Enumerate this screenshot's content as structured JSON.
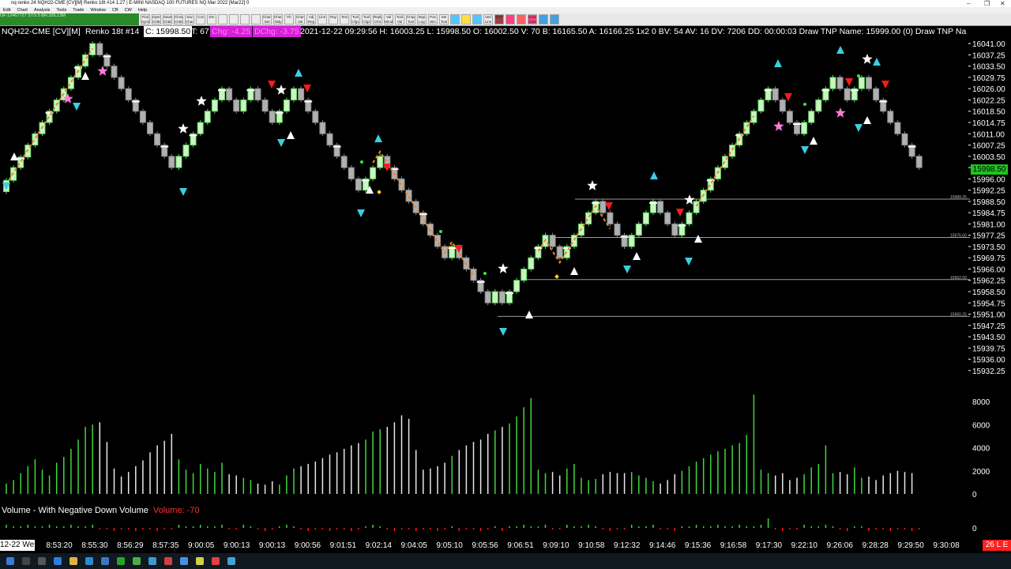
{
  "window": {
    "title": "nq renko 24 NQH22-CME [CV][M] Renko 18t #14 1.27 | E-MINI NASDAQ 100 FUTURES NQ Mar 2022 [Mar22]  0",
    "controls": [
      "–",
      "❐",
      "✕"
    ]
  },
  "menu": [
    "Edit",
    "Chart",
    "Analysis",
    "Tools",
    "Trade",
    "Window",
    "CB",
    "CW",
    "Help"
  ],
  "statuschip": "OF:12467727 ST:5.5 BR:326.13M",
  "toolbar": [
    "Find Symb",
    "Open Chtbook",
    "Save Chtbook",
    "Close Chtbook",
    "Sav Chart",
    "Con",
    "Dm",
    "",
    "",
    "",
    "",
    "Chart Set",
    "Chart Stdy",
    "Fb",
    "Chart Val",
    "Adj Reg",
    "Line",
    "Ray",
    "Text",
    "Tool Cfg1",
    "Tool Cfg2",
    "Replay Chrt",
    "Val Wind",
    "Tool Val",
    "Cmpct Tool Vol",
    "Myp Log",
    "Pos Win",
    "Ste Tool",
    "",
    "",
    "",
    "Vert Line",
    "DVP",
    "",
    "",
    "Erase Lines",
    "",
    ""
  ],
  "infobar": {
    "symbol": "NQH22-CME [CV][M]",
    "bars": "Renko 18t #14",
    "close": "C: 15998.50",
    "ticks": "T: 67",
    "chg": "Chg: -4.25",
    "dchg": "DChg: -3.75",
    "details": "2021-12-22 09:29:56 H: 16003.25 L: 15998.50 O: 16002.50 V: 70 B: 16165.50 A: 16166.25 1x2 0 BV: 54 AV: 16 DV: 7206 DD: 00:00:03 Draw TNP  Name: 15999.00  (0)  Draw TNP  Na"
  },
  "price_axis": [
    "16041.00",
    "16037.25",
    "16033.50",
    "16029.75",
    "16026.00",
    "16022.25",
    "16018.50",
    "16014.75",
    "16011.00",
    "16007.25",
    "16003.50",
    "15999.75",
    "15996.00",
    "15992.25",
    "15988.50",
    "15984.75",
    "15981.00",
    "15977.25",
    "15973.50",
    "15969.75",
    "15966.00",
    "15962.25",
    "15958.50",
    "15954.75",
    "15951.00",
    "15947.25",
    "15943.50",
    "15939.75",
    "15936.00",
    "15932.25"
  ],
  "last_price": "15998.50",
  "hlines": [
    {
      "label": "15989.25",
      "price": 15989.25
    },
    {
      "label": "15976.50",
      "price": 15976.5
    },
    {
      "label": "15962.50",
      "price": 15962.5
    },
    {
      "label": "15950.25",
      "price": 15950.25
    }
  ],
  "volume_axis": [
    "8000",
    "6000",
    "4000",
    "2000",
    "0"
  ],
  "delta_axis": "0",
  "volume_study": {
    "title": "Volume - With Negative Down Volume",
    "value": "Volume: -70"
  },
  "time_axis": [
    "8:53:20",
    "8:55:30",
    "8:56:29",
    "8:57:35",
    "9:00:05",
    "9:00:13",
    "9:00:13",
    "9:00:56",
    "9:01:51",
    "9:02:14",
    "9:04:05",
    "9:05:10",
    "9:05:56",
    "9:06:51",
    "9:09:10",
    "9:10:58",
    "9:12:32",
    "9:14:46",
    "9:15:36",
    "9:16:58",
    "9:17:30",
    "9:22:10",
    "9:26:06",
    "9:28:28",
    "9:29:50",
    "9:30:08"
  ],
  "date_box": "12-22 We",
  "now_box": "26 L E",
  "colors": {
    "up": "#5fd35f",
    "up_fill": "#c8f5c0",
    "down": "#8a8a8a",
    "down_fill": "#b0b0b0",
    "signal_orange": "#e8862a",
    "sell": "#ff1a1a",
    "buy_arrow": "#39d0e0",
    "star_pink": "#ff7ad9",
    "vol_up": "#3fd83f",
    "vol_down": "#e8e8e8"
  },
  "chart_data": {
    "type": "renko",
    "bricks_close": [
      15995.5,
      15999.75,
      16003.25,
      16007.25,
      16011,
      16014.75,
      16018.5,
      16022.25,
      16026,
      16029.75,
      16033.5,
      16037.25,
      16041,
      16037.25,
      16033.5,
      16029.75,
      16026,
      16022.25,
      16018.5,
      16014.75,
      16011,
      16007.25,
      16003.5,
      15999.75,
      16003.5,
      16007.25,
      16011,
      16014.75,
      16018.5,
      16022.25,
      16026,
      16022.25,
      16018.5,
      16022.25,
      16026,
      16022.25,
      16018.5,
      16014.75,
      16018.5,
      16022.25,
      16026,
      16022.25,
      16018.5,
      16014.75,
      16011,
      16007.25,
      16003.5,
      15999.75,
      15996,
      15992.25,
      15996,
      15999.75,
      16003.5,
      15999.75,
      15996,
      15992.25,
      15988.5,
      15984.75,
      15981,
      15977.25,
      15973.5,
      15969.75,
      15973.5,
      15969.75,
      15966,
      15962.25,
      15958.5,
      15954.75,
      15958.5,
      15954.75,
      15958.5,
      15962.25,
      15966,
      15969.75,
      15973.5,
      15977.25,
      15973.5,
      15969.75,
      15973.5,
      15977.25,
      15981,
      15984.75,
      15988.5,
      15984.75,
      15981,
      15977.25,
      15973.5,
      15977.25,
      15981,
      15984.75,
      15988.5,
      15984.75,
      15981,
      15977.25,
      15981,
      15984.75,
      15988.5,
      15992.25,
      15996,
      15999.75,
      16003.5,
      16007.25,
      16011,
      16014.75,
      16018.5,
      16022.25,
      16026,
      16022.25,
      16018.5,
      16014.75,
      16011,
      16014.75,
      16018.5,
      16022.25,
      16026,
      16029.75,
      16026,
      16022.25,
      16026,
      16029.75,
      16026,
      16022.25,
      16018.5,
      16014.75,
      16011,
      16007.25,
      16003.5,
      15999.75
    ],
    "volume": [
      900,
      1200,
      1800,
      2400,
      3000,
      2100,
      1600,
      2700,
      3200,
      3900,
      4700,
      5800,
      6000,
      6200,
      4500,
      2200,
      1500,
      1900,
      2400,
      2900,
      3600,
      4200,
      4600,
      5200,
      3000,
      2100,
      1800,
      2600,
      2200,
      1900,
      2700,
      1700,
      1600,
      1400,
      1200,
      900,
      800,
      1100,
      800,
      1600,
      2200,
      2400,
      2600,
      2800,
      3100,
      3400,
      3600,
      3900,
      4200,
      4400,
      4700,
      5400,
      5600,
      5800,
      6200,
      6800,
      6500,
      3800,
      2100,
      2200,
      2400,
      2700,
      3300,
      3800,
      4200,
      4500,
      4700,
      5200,
      5500,
      5800,
      6100,
      6700,
      7500,
      8300,
      2100,
      1800,
      1900,
      1600,
      2200,
      2600,
      1400,
      1200,
      1300,
      1700,
      1900,
      1800,
      1800,
      1900,
      1600,
      1400,
      1100,
      900,
      1200,
      1700,
      2000,
      2400,
      2800,
      3100,
      3400,
      3700,
      3900,
      4200,
      4400,
      5100,
      8600,
      2100,
      1800,
      1600,
      1800,
      1200,
      1400,
      1700,
      2300,
      2600,
      4200,
      1800,
      1900,
      1700,
      2300,
      1400,
      1500,
      1200,
      1600,
      1800,
      2000,
      1900,
      1800
    ],
    "ylim": [
      15930.375,
      16042.875
    ]
  }
}
